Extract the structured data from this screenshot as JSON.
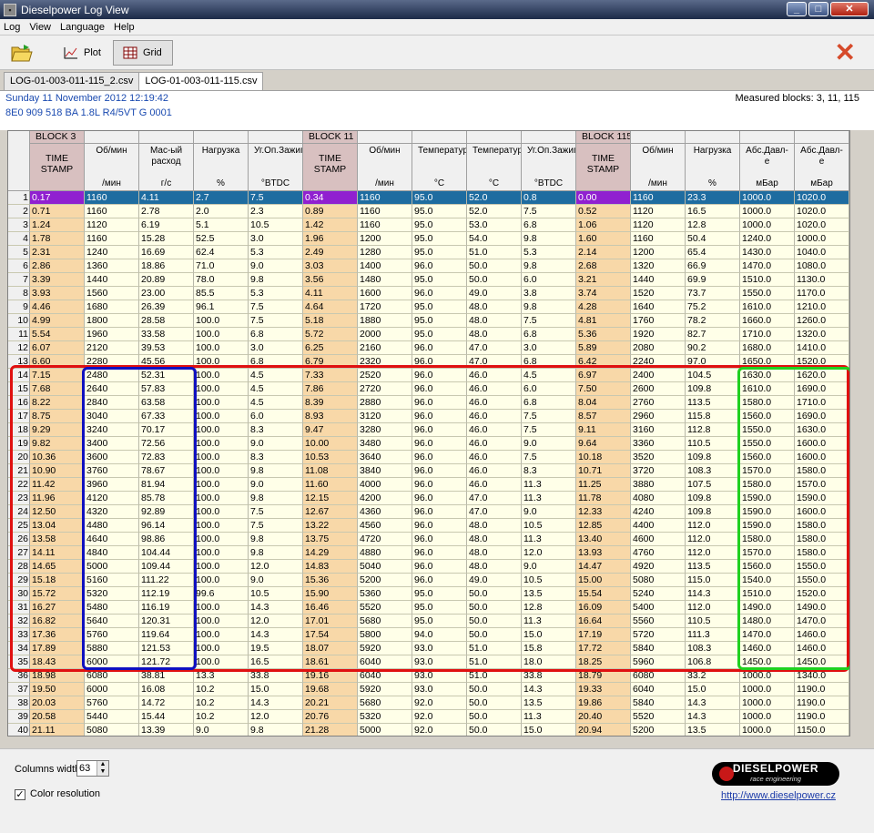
{
  "window": {
    "title": "Dieselpower Log View"
  },
  "menu": [
    "Log",
    "View",
    "Language",
    "Help"
  ],
  "toolbar": {
    "plot_label": "Plot",
    "grid_label": "Grid"
  },
  "tabs": [
    "LOG-01-003-011-115_2.csv",
    "LOG-01-003-011-115.csv"
  ],
  "info": {
    "date": "Sunday 11 November 2012 12:19:42",
    "ecu": "8E0 909 518 BA  1.8L R4/5VT     G    0001",
    "measured_blocks": "Measured blocks: 3, 11, 115"
  },
  "grid": {
    "blocks": [
      "BLOCK 3",
      "BLOCK 11",
      "BLOCK 115"
    ],
    "columns": [
      {
        "name": "TIME STAMP",
        "unit": ""
      },
      {
        "name": "Об/мин",
        "unit": "/мин"
      },
      {
        "name": "Мас-ый расход",
        "unit": "г/с"
      },
      {
        "name": "Нагрузка",
        "unit": "%"
      },
      {
        "name": "Уг.Оп.Зажиг",
        "unit": "°BTDC"
      },
      {
        "name": "TIME STAMP",
        "unit": ""
      },
      {
        "name": "Об/мин",
        "unit": "/мин"
      },
      {
        "name": "Температура",
        "unit": "°C"
      },
      {
        "name": "Температура",
        "unit": "°C"
      },
      {
        "name": "Уг.Оп.Зажиг",
        "unit": "°BTDC"
      },
      {
        "name": "TIME STAMP",
        "unit": ""
      },
      {
        "name": "Об/мин",
        "unit": "/мин"
      },
      {
        "name": "Нагрузка",
        "unit": "%"
      },
      {
        "name": "Абс.Давл-е",
        "unit": "мБар"
      },
      {
        "name": "Абс.Давл-е",
        "unit": "мБар"
      }
    ],
    "rows": [
      [
        "0.17",
        "1160",
        "4.11",
        "2.7",
        "7.5",
        "0.34",
        "1160",
        "95.0",
        "52.0",
        "0.8",
        "0.00",
        "1160",
        "23.3",
        "1000.0",
        "1020.0"
      ],
      [
        "0.71",
        "1160",
        "2.78",
        "2.0",
        "2.3",
        "0.89",
        "1160",
        "95.0",
        "52.0",
        "7.5",
        "0.52",
        "1120",
        "16.5",
        "1000.0",
        "1020.0"
      ],
      [
        "1.24",
        "1120",
        "6.19",
        "5.1",
        "10.5",
        "1.42",
        "1160",
        "95.0",
        "53.0",
        "6.8",
        "1.06",
        "1120",
        "12.8",
        "1000.0",
        "1020.0"
      ],
      [
        "1.78",
        "1160",
        "15.28",
        "52.5",
        "3.0",
        "1.96",
        "1200",
        "95.0",
        "54.0",
        "9.8",
        "1.60",
        "1160",
        "50.4",
        "1240.0",
        "1000.0"
      ],
      [
        "2.31",
        "1240",
        "16.69",
        "62.4",
        "5.3",
        "2.49",
        "1280",
        "95.0",
        "51.0",
        "5.3",
        "2.14",
        "1200",
        "65.4",
        "1430.0",
        "1040.0"
      ],
      [
        "2.86",
        "1360",
        "18.86",
        "71.0",
        "9.0",
        "3.03",
        "1400",
        "96.0",
        "50.0",
        "9.8",
        "2.68",
        "1320",
        "66.9",
        "1470.0",
        "1080.0"
      ],
      [
        "3.39",
        "1440",
        "20.89",
        "78.0",
        "9.8",
        "3.56",
        "1480",
        "95.0",
        "50.0",
        "6.0",
        "3.21",
        "1440",
        "69.9",
        "1510.0",
        "1130.0"
      ],
      [
        "3.93",
        "1560",
        "23.00",
        "85.5",
        "5.3",
        "4.11",
        "1600",
        "96.0",
        "49.0",
        "3.8",
        "3.74",
        "1520",
        "73.7",
        "1550.0",
        "1170.0"
      ],
      [
        "4.46",
        "1680",
        "26.39",
        "96.1",
        "7.5",
        "4.64",
        "1720",
        "95.0",
        "48.0",
        "9.8",
        "4.28",
        "1640",
        "75.2",
        "1610.0",
        "1210.0"
      ],
      [
        "4.99",
        "1800",
        "28.58",
        "100.0",
        "7.5",
        "5.18",
        "1880",
        "95.0",
        "48.0",
        "7.5",
        "4.81",
        "1760",
        "78.2",
        "1660.0",
        "1260.0"
      ],
      [
        "5.54",
        "1960",
        "33.58",
        "100.0",
        "6.8",
        "5.72",
        "2000",
        "95.0",
        "48.0",
        "6.8",
        "5.36",
        "1920",
        "82.7",
        "1710.0",
        "1320.0"
      ],
      [
        "6.07",
        "2120",
        "39.53",
        "100.0",
        "3.0",
        "6.25",
        "2160",
        "96.0",
        "47.0",
        "3.0",
        "5.89",
        "2080",
        "90.2",
        "1680.0",
        "1410.0"
      ],
      [
        "6.60",
        "2280",
        "45.56",
        "100.0",
        "6.8",
        "6.79",
        "2320",
        "96.0",
        "47.0",
        "6.8",
        "6.42",
        "2240",
        "97.0",
        "1650.0",
        "1520.0"
      ],
      [
        "7.15",
        "2480",
        "52.31",
        "100.0",
        "4.5",
        "7.33",
        "2520",
        "96.0",
        "46.0",
        "4.5",
        "6.97",
        "2400",
        "104.5",
        "1630.0",
        "1620.0"
      ],
      [
        "7.68",
        "2640",
        "57.83",
        "100.0",
        "4.5",
        "7.86",
        "2720",
        "96.0",
        "46.0",
        "6.0",
        "7.50",
        "2600",
        "109.8",
        "1610.0",
        "1690.0"
      ],
      [
        "8.22",
        "2840",
        "63.58",
        "100.0",
        "4.5",
        "8.39",
        "2880",
        "96.0",
        "46.0",
        "6.8",
        "8.04",
        "2760",
        "113.5",
        "1580.0",
        "1710.0"
      ],
      [
        "8.75",
        "3040",
        "67.33",
        "100.0",
        "6.0",
        "8.93",
        "3120",
        "96.0",
        "46.0",
        "7.5",
        "8.57",
        "2960",
        "115.8",
        "1560.0",
        "1690.0"
      ],
      [
        "9.29",
        "3240",
        "70.17",
        "100.0",
        "8.3",
        "9.47",
        "3280",
        "96.0",
        "46.0",
        "7.5",
        "9.11",
        "3160",
        "112.8",
        "1550.0",
        "1630.0"
      ],
      [
        "9.82",
        "3400",
        "72.56",
        "100.0",
        "9.0",
        "10.00",
        "3480",
        "96.0",
        "46.0",
        "9.0",
        "9.64",
        "3360",
        "110.5",
        "1550.0",
        "1600.0"
      ],
      [
        "10.36",
        "3600",
        "72.83",
        "100.0",
        "8.3",
        "10.53",
        "3640",
        "96.0",
        "46.0",
        "7.5",
        "10.18",
        "3520",
        "109.8",
        "1560.0",
        "1600.0"
      ],
      [
        "10.90",
        "3760",
        "78.67",
        "100.0",
        "9.8",
        "11.08",
        "3840",
        "96.0",
        "46.0",
        "8.3",
        "10.71",
        "3720",
        "108.3",
        "1570.0",
        "1580.0"
      ],
      [
        "11.42",
        "3960",
        "81.94",
        "100.0",
        "9.0",
        "11.60",
        "4000",
        "96.0",
        "46.0",
        "11.3",
        "11.25",
        "3880",
        "107.5",
        "1580.0",
        "1570.0"
      ],
      [
        "11.96",
        "4120",
        "85.78",
        "100.0",
        "9.8",
        "12.15",
        "4200",
        "96.0",
        "47.0",
        "11.3",
        "11.78",
        "4080",
        "109.8",
        "1590.0",
        "1590.0"
      ],
      [
        "12.50",
        "4320",
        "92.89",
        "100.0",
        "7.5",
        "12.67",
        "4360",
        "96.0",
        "47.0",
        "9.0",
        "12.33",
        "4240",
        "109.8",
        "1590.0",
        "1600.0"
      ],
      [
        "13.04",
        "4480",
        "96.14",
        "100.0",
        "7.5",
        "13.22",
        "4560",
        "96.0",
        "48.0",
        "10.5",
        "12.85",
        "4400",
        "112.0",
        "1590.0",
        "1580.0"
      ],
      [
        "13.58",
        "4640",
        "98.86",
        "100.0",
        "9.8",
        "13.75",
        "4720",
        "96.0",
        "48.0",
        "11.3",
        "13.40",
        "4600",
        "112.0",
        "1580.0",
        "1580.0"
      ],
      [
        "14.11",
        "4840",
        "104.44",
        "100.0",
        "9.8",
        "14.29",
        "4880",
        "96.0",
        "48.0",
        "12.0",
        "13.93",
        "4760",
        "112.0",
        "1570.0",
        "1580.0"
      ],
      [
        "14.65",
        "5000",
        "109.44",
        "100.0",
        "12.0",
        "14.83",
        "5040",
        "96.0",
        "48.0",
        "9.0",
        "14.47",
        "4920",
        "113.5",
        "1560.0",
        "1550.0"
      ],
      [
        "15.18",
        "5160",
        "111.22",
        "100.0",
        "9.0",
        "15.36",
        "5200",
        "96.0",
        "49.0",
        "10.5",
        "15.00",
        "5080",
        "115.0",
        "1540.0",
        "1550.0"
      ],
      [
        "15.72",
        "5320",
        "112.19",
        "99.6",
        "10.5",
        "15.90",
        "5360",
        "95.0",
        "50.0",
        "13.5",
        "15.54",
        "5240",
        "114.3",
        "1510.0",
        "1520.0"
      ],
      [
        "16.27",
        "5480",
        "116.19",
        "100.0",
        "14.3",
        "16.46",
        "5520",
        "95.0",
        "50.0",
        "12.8",
        "16.09",
        "5400",
        "112.0",
        "1490.0",
        "1490.0"
      ],
      [
        "16.82",
        "5640",
        "120.31",
        "100.0",
        "12.0",
        "17.01",
        "5680",
        "95.0",
        "50.0",
        "11.3",
        "16.64",
        "5560",
        "110.5",
        "1480.0",
        "1470.0"
      ],
      [
        "17.36",
        "5760",
        "119.64",
        "100.0",
        "14.3",
        "17.54",
        "5800",
        "94.0",
        "50.0",
        "15.0",
        "17.19",
        "5720",
        "111.3",
        "1470.0",
        "1460.0"
      ],
      [
        "17.89",
        "5880",
        "121.53",
        "100.0",
        "19.5",
        "18.07",
        "5920",
        "93.0",
        "51.0",
        "15.8",
        "17.72",
        "5840",
        "108.3",
        "1460.0",
        "1460.0"
      ],
      [
        "18.43",
        "6000",
        "121.72",
        "100.0",
        "16.5",
        "18.61",
        "6040",
        "93.0",
        "51.0",
        "18.0",
        "18.25",
        "5960",
        "106.8",
        "1450.0",
        "1450.0"
      ],
      [
        "18.98",
        "6080",
        "38.81",
        "13.3",
        "33.8",
        "19.16",
        "6040",
        "93.0",
        "51.0",
        "33.8",
        "18.79",
        "6080",
        "33.2",
        "1000.0",
        "1340.0"
      ],
      [
        "19.50",
        "6000",
        "16.08",
        "10.2",
        "15.0",
        "19.68",
        "5920",
        "93.0",
        "50.0",
        "14.3",
        "19.33",
        "6040",
        "15.0",
        "1000.0",
        "1190.0"
      ],
      [
        "20.03",
        "5760",
        "14.72",
        "10.2",
        "14.3",
        "20.21",
        "5680",
        "92.0",
        "50.0",
        "13.5",
        "19.86",
        "5840",
        "14.3",
        "1000.0",
        "1190.0"
      ],
      [
        "20.58",
        "5440",
        "15.44",
        "10.2",
        "12.0",
        "20.76",
        "5320",
        "92.0",
        "50.0",
        "11.3",
        "20.40",
        "5520",
        "14.3",
        "1000.0",
        "1190.0"
      ],
      [
        "21.11",
        "5080",
        "13.39",
        "9.0",
        "9.8",
        "21.28",
        "5000",
        "92.0",
        "50.0",
        "15.0",
        "20.94",
        "5200",
        "13.5",
        "1000.0",
        "1150.0"
      ]
    ]
  },
  "bottom": {
    "columns_width_label": "Columns width:",
    "columns_width_value": "63",
    "color_resolution_label": "Color resolution",
    "color_resolution_checked": "✓"
  },
  "logo": {
    "name": "DIESELPOWER",
    "tagline": "race engineering"
  },
  "url": "http://www.dieselpower.cz",
  "highlight_colors": {
    "red": "#e01010",
    "blue": "#1010c0",
    "green": "#20d020"
  }
}
